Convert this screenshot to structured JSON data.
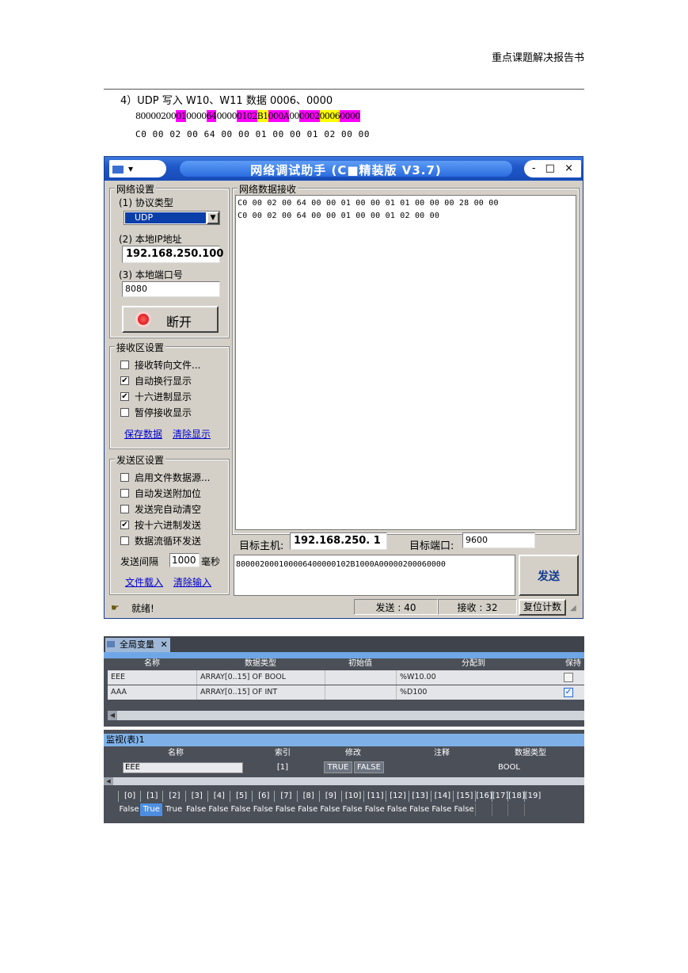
{
  "doc": {
    "header_title": "重点课题解决报告书",
    "section_heading": "4）UDP  写入 W10、W11 数据 0006、0000",
    "hex_segments": [
      {
        "text": "80000200",
        "bg": ""
      },
      {
        "text": "01",
        "bg": "#ff00ff"
      },
      {
        "text": "0000",
        "bg": ""
      },
      {
        "text": "64",
        "bg": "#ff00ff"
      },
      {
        "text": "0000",
        "bg": ""
      },
      {
        "text": "0102",
        "bg": "#ff00ff"
      },
      {
        "text": "B1",
        "bg": "#ffff00"
      },
      {
        "text": "000A",
        "bg": "#ff00ff"
      },
      {
        "text": "00",
        "bg": ""
      },
      {
        "text": "0002",
        "bg": "#ff00ff"
      },
      {
        "text": "0006",
        "bg": "#ffff00"
      },
      {
        "text": "0000",
        "bg": "#ff00ff"
      }
    ],
    "response_line": "C0 00 02 00 64 00 00 01 00 00 01 02 00 00"
  },
  "app": {
    "title": "网络调试助手 (C■精装版 V3.7)",
    "controls": "- □ ×",
    "net_group": "网络设置",
    "protocol_label": "(1) 协议类型",
    "protocol_value": "UDP",
    "local_ip_label": "(2) 本地IP地址",
    "local_ip_value": "192.168.250.100",
    "local_port_label": "(3) 本地端口号",
    "local_port_value": "8080",
    "disconnect_label": "断开",
    "rx_group": "接收区设置",
    "rx_options": [
      {
        "label": "接收转向文件...",
        "checked": false
      },
      {
        "label": "自动换行显示",
        "checked": true
      },
      {
        "label": "十六进制显示",
        "checked": true
      },
      {
        "label": "暂停接收显示",
        "checked": false
      }
    ],
    "save_data": "保存数据",
    "clear_display": "清除显示",
    "tx_group": "发送区设置",
    "tx_options": [
      {
        "label": "启用文件数据源...",
        "checked": false
      },
      {
        "label": "自动发送附加位",
        "checked": false
      },
      {
        "label": "发送完自动清空",
        "checked": false
      },
      {
        "label": "按十六进制发送",
        "checked": true
      },
      {
        "label": "数据流循环发送",
        "checked": false
      }
    ],
    "interval_label": "发送间隔",
    "interval_value": "1000",
    "interval_unit": "毫秒",
    "file_load": "文件载入",
    "clear_input": "清除输入",
    "rx_data_group": "网络数据接收",
    "rx_lines": [
      "C0 00 02 00 64 00 00 01 00 00 01 01 00 00 00 28 00 00",
      "C0 00 02 00 64 00 00 01 00 00 01 02 00 00"
    ],
    "target_host_label": "目标主机:",
    "target_host_value": "192.168.250. 1",
    "target_port_label": "目标端口:",
    "target_port_value": "9600",
    "tx_data": "800002000100006400000102B1000A00000200060000",
    "send_label": "发送",
    "status_ready": "就绪!",
    "sent_label": "发送 : 40",
    "recv_label": "接收 : 32",
    "reset_label": "复位计数"
  },
  "globals": {
    "tab_label": "全局变量",
    "columns": [
      "名称",
      "数据类型",
      "初始值",
      "分配到",
      "保持"
    ],
    "rows": [
      {
        "name": "EEE",
        "type": "ARRAY[0..15] OF BOOL",
        "init": "",
        "at": "%W10.00",
        "retain": false
      },
      {
        "name": "AAA",
        "type": "ARRAY[0..15] OF INT",
        "init": "",
        "at": "%D100",
        "retain": true
      }
    ]
  },
  "watch": {
    "title": "监视(表)1",
    "columns": [
      "名称",
      "索引",
      "修改",
      "注释",
      "数据类型"
    ],
    "row": {
      "name": "EEE",
      "index": "[1]",
      "btn_true": "TRUE",
      "btn_false": "FALSE",
      "comment": "",
      "type": "BOOL"
    },
    "indices": [
      "[0]",
      "[1]",
      "[2]",
      "[3]",
      "[4]",
      "[5]",
      "[6]",
      "[7]",
      "[8]",
      "[9]",
      "[10]",
      "[11]",
      "[12]",
      "[13]",
      "[14]",
      "[15]",
      "[16]",
      "[17]",
      "[18]",
      "[19]"
    ],
    "values": [
      "False",
      "True",
      "True",
      "False",
      "False",
      "False",
      "False",
      "False",
      "False",
      "False",
      "False",
      "False",
      "False",
      "False",
      "False",
      "False"
    ]
  }
}
